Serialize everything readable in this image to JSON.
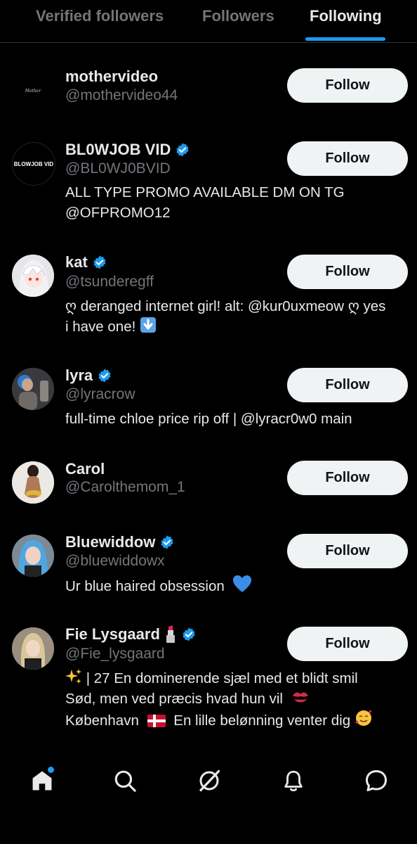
{
  "tabs": [
    {
      "label": "Verified followers"
    },
    {
      "label": "Followers"
    },
    {
      "label": "Following",
      "active": true
    }
  ],
  "follow_label": "Follow",
  "accounts": [
    {
      "name": "mothervideo",
      "handle": "@mothervideo44",
      "verified": false,
      "bio": "",
      "avatar_text": "Mother"
    },
    {
      "name": "BL0WJOB VID",
      "handle": "@BL0WJ0BVID",
      "verified": true,
      "bio": "ALL TYPE PROMO AVAILABLE DM ON TG @OFPROMO12",
      "avatar_text": "BLOWJOB VID"
    },
    {
      "name": "kat",
      "handle": "@tsunderegff",
      "verified": true,
      "bio": "ღ deranged internet girl! alt: @kur0uxmeow ღ yes i have one!"
    },
    {
      "name": "lyra",
      "handle": "@lyracrow",
      "verified": true,
      "bio": "full-time chloe price rip off | @lyracr0w0 main"
    },
    {
      "name": "Carol",
      "handle": "@Carolthemom_1",
      "verified": false,
      "bio": ""
    },
    {
      "name": "Bluewiddow",
      "handle": "@bluewiddowx",
      "verified": true,
      "bio": "Ur blue haired obsession"
    },
    {
      "name": "Fie Lysgaard",
      "handle": "@Fie_lysgaard",
      "verified": true,
      "bio_lines": [
        "| 27 En dominerende sjæl med et blidt smil",
        "Sød, men ved præcis hvad hun vil",
        "København",
        "En lille belønning venter dig"
      ]
    }
  ],
  "nav": [
    "home-icon",
    "search-icon",
    "grok-icon",
    "notifications-icon",
    "messages-icon"
  ],
  "colors": {
    "accent": "#1d9bf0",
    "muted": "#71767b",
    "text": "#e7e9ea",
    "button_bg": "#eff3f4"
  }
}
